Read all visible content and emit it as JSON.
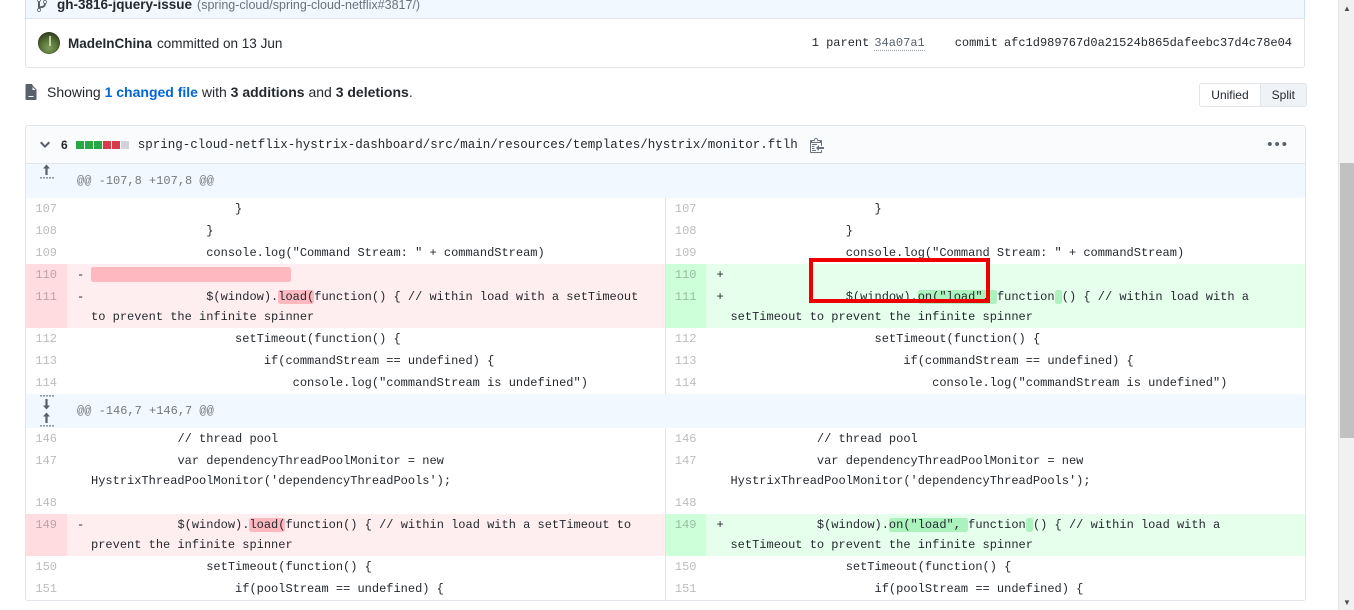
{
  "branch": {
    "icon": "git-branch-icon",
    "name": "gh-3816-jquery-issue",
    "repo": "(spring-cloud/spring-cloud-netflix#3817/)"
  },
  "commit": {
    "author": "MadeInChina",
    "when": "committed on 13 Jun",
    "parent_label": "1 parent",
    "parent_sha": "34a07a1",
    "commit_label": "commit",
    "commit_sha": "afc1d989767d0a21524b865dafeebc37d4c78e04"
  },
  "showing": {
    "icon": "diff-icon",
    "prefix": "Showing",
    "changed_file": "1 changed file",
    "with": "with",
    "additions": "3 additions",
    "and": "and",
    "deletions": "3 deletions",
    "period": "."
  },
  "toggle": {
    "unified": "Unified",
    "split": "Split",
    "selected": "Split"
  },
  "file": {
    "chevron": "chevron-down-icon",
    "stat_count": "6",
    "blocks": [
      "#28a745",
      "#28a745",
      "#28a745",
      "#d73a49",
      "#d73a49",
      "#d1d5da"
    ],
    "path": "spring-cloud-netflix-hystrix-dashboard/src/main/resources/templates/hystrix/monitor.ftlh",
    "copy_icon": "copy-icon",
    "kebab": "•••"
  },
  "hunks": [
    {
      "header": "@@ -107,8 +107,8 @@",
      "expander": "expand-up-icon",
      "rows": [
        {
          "type": "ctx",
          "lnum_l": "107",
          "lnum_r": "107",
          "sign_l": "",
          "sign_r": "",
          "left": [
            {
              "t": "                    }"
            }
          ],
          "right": [
            {
              "t": "                    }"
            }
          ]
        },
        {
          "type": "ctx",
          "lnum_l": "108",
          "lnum_r": "108",
          "sign_l": "",
          "sign_r": "",
          "left": [
            {
              "t": "                }"
            }
          ],
          "right": [
            {
              "t": "                }"
            }
          ]
        },
        {
          "type": "ctx",
          "lnum_l": "109",
          "lnum_r": "109",
          "sign_l": "",
          "sign_r": "",
          "left": [
            {
              "t": "                console.log(\"Command Stream: \" + commandStream)"
            }
          ],
          "right": [
            {
              "t": "                console.log(\"Command Stream: \" + commandStream)"
            }
          ]
        },
        {
          "type": "change",
          "lnum_l": "110",
          "lnum_r": "110",
          "sign_l": "-",
          "sign_r": "+",
          "left": [
            {
              "t": "",
              "hl": "del-blank"
            }
          ],
          "right": [
            {
              "t": ""
            }
          ]
        },
        {
          "type": "change",
          "lnum_l": "111",
          "lnum_r": "111",
          "sign_l": "-",
          "sign_r": "+",
          "left": [
            {
              "t": "                $(window)."
            },
            {
              "t": "load(",
              "hl": "del"
            },
            {
              "t": "function() { // within load with a setTimeout to prevent the infinite spinner"
            }
          ],
          "right": [
            {
              "t": "                $(window)."
            },
            {
              "t": "on(\"load\", ",
              "hl": "add"
            },
            {
              "t": "function"
            },
            {
              "t": " ",
              "hl": "add"
            },
            {
              "t": "() { // within load with a setTimeout to prevent the infinite spinner"
            }
          ]
        },
        {
          "type": "ctx",
          "lnum_l": "112",
          "lnum_r": "112",
          "sign_l": "",
          "sign_r": "",
          "left": [
            {
              "t": "                    setTimeout(function() {"
            }
          ],
          "right": [
            {
              "t": "                    setTimeout(function() {"
            }
          ]
        },
        {
          "type": "ctx",
          "lnum_l": "113",
          "lnum_r": "113",
          "sign_l": "",
          "sign_r": "",
          "left": [
            {
              "t": "                        if(commandStream == undefined) {"
            }
          ],
          "right": [
            {
              "t": "                        if(commandStream == undefined) {"
            }
          ]
        },
        {
          "type": "ctx",
          "lnum_l": "114",
          "lnum_r": "114",
          "sign_l": "",
          "sign_r": "",
          "left": [
            {
              "t": "                            console.log(\"commandStream is undefined\")"
            }
          ],
          "right": [
            {
              "t": "                            console.log(\"commandStream is undefined\")"
            }
          ]
        }
      ]
    },
    {
      "header": "@@ -146,7 +146,7 @@",
      "expander": "expand-up-down-icon",
      "rows": [
        {
          "type": "ctx",
          "lnum_l": "146",
          "lnum_r": "146",
          "sign_l": "",
          "sign_r": "",
          "left": [
            {
              "t": "            // thread pool"
            }
          ],
          "right": [
            {
              "t": "            // thread pool"
            }
          ]
        },
        {
          "type": "ctx",
          "lnum_l": "147",
          "lnum_r": "147",
          "sign_l": "",
          "sign_r": "",
          "left": [
            {
              "t": "            var dependencyThreadPoolMonitor = new HystrixThreadPoolMonitor('dependencyThreadPools');"
            }
          ],
          "right": [
            {
              "t": "            var dependencyThreadPoolMonitor = new HystrixThreadPoolMonitor('dependencyThreadPools');"
            }
          ]
        },
        {
          "type": "ctx",
          "lnum_l": "148",
          "lnum_r": "148",
          "sign_l": "",
          "sign_r": "",
          "left": [
            {
              "t": ""
            }
          ],
          "right": [
            {
              "t": ""
            }
          ]
        },
        {
          "type": "change",
          "lnum_l": "149",
          "lnum_r": "149",
          "sign_l": "-",
          "sign_r": "+",
          "left": [
            {
              "t": "            $(window)."
            },
            {
              "t": "load(",
              "hl": "del"
            },
            {
              "t": "function() { // within load with a setTimeout to prevent the infinite spinner"
            }
          ],
          "right": [
            {
              "t": "            $(window)."
            },
            {
              "t": "on(\"load\", ",
              "hl": "add"
            },
            {
              "t": "function"
            },
            {
              "t": " ",
              "hl": "add"
            },
            {
              "t": "() { // within load with a setTimeout to prevent the infinite spinner"
            }
          ]
        },
        {
          "type": "ctx",
          "lnum_l": "150",
          "lnum_r": "150",
          "sign_l": "",
          "sign_r": "",
          "left": [
            {
              "t": "                setTimeout(function() {"
            }
          ],
          "right": [
            {
              "t": "                setTimeout(function() {"
            }
          ]
        },
        {
          "type": "ctx",
          "lnum_l": "151",
          "lnum_r": "151",
          "sign_l": "",
          "sign_r": "",
          "left": [
            {
              "t": "                    if(poolStream == undefined) {"
            }
          ],
          "right": [
            {
              "t": "                    if(poolStream == undefined) {"
            }
          ]
        }
      ]
    }
  ],
  "annotation": {
    "shape": "red-rectangle-highlight"
  },
  "scrollbar": {
    "up": "▲",
    "down": "▼"
  }
}
